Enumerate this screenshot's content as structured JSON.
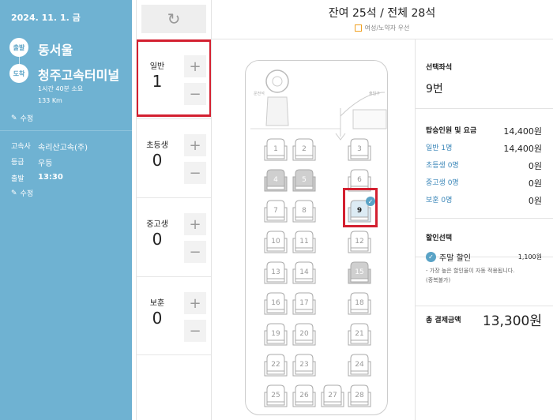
{
  "sidebar": {
    "date": "2024. 11. 1. 금",
    "departure": {
      "badge": "출발",
      "name": "동서울"
    },
    "arrival": {
      "badge": "도착",
      "name": "청주고속터미널",
      "duration": "1시간 40분 소요",
      "distance": "133 Km"
    },
    "edit_label": "수정",
    "info": [
      {
        "key": "고속사",
        "value": "속리산고속(주)"
      },
      {
        "key": "등급",
        "value": "우등"
      },
      {
        "key": "출발",
        "value": "13:30"
      }
    ],
    "edit_label_2": "수정"
  },
  "passengers": {
    "refresh_icon": "↻",
    "types": [
      {
        "label": "일반",
        "count": "1"
      },
      {
        "label": "초등생",
        "count": "0"
      },
      {
        "label": "중고생",
        "count": "0"
      },
      {
        "label": "보훈",
        "count": "0"
      }
    ],
    "plus": "+",
    "minus": "−"
  },
  "header": {
    "title": "잔여 25석 / 전체 28석",
    "legend": "여성/노약자 우선"
  },
  "bus": {
    "left_label": "운전석",
    "right_label": "출입구",
    "seats": [
      {
        "n": "1",
        "s": "free"
      },
      {
        "n": "2",
        "s": "free"
      },
      {
        "n": "3",
        "s": "free"
      },
      {
        "n": "4",
        "s": "taken"
      },
      {
        "n": "5",
        "s": "taken"
      },
      {
        "n": "6",
        "s": "free"
      },
      {
        "n": "7",
        "s": "free"
      },
      {
        "n": "8",
        "s": "free"
      },
      {
        "n": "9",
        "s": "selected"
      },
      {
        "n": "10",
        "s": "free"
      },
      {
        "n": "11",
        "s": "free"
      },
      {
        "n": "12",
        "s": "free"
      },
      {
        "n": "13",
        "s": "free"
      },
      {
        "n": "14",
        "s": "free"
      },
      {
        "n": "15",
        "s": "taken"
      },
      {
        "n": "16",
        "s": "free"
      },
      {
        "n": "17",
        "s": "free"
      },
      {
        "n": "18",
        "s": "free"
      },
      {
        "n": "19",
        "s": "free"
      },
      {
        "n": "20",
        "s": "free"
      },
      {
        "n": "21",
        "s": "free"
      },
      {
        "n": "22",
        "s": "free"
      },
      {
        "n": "23",
        "s": "free"
      },
      {
        "n": "24",
        "s": "free"
      },
      {
        "n": "25",
        "s": "free"
      },
      {
        "n": "26",
        "s": "free"
      },
      {
        "n": "27",
        "s": "free"
      },
      {
        "n": "28",
        "s": "free"
      }
    ]
  },
  "summary": {
    "selected_title": "선택좌석",
    "selected_seat": "9번",
    "fare_title": "탑승인원 및 요금",
    "fare_total": "14,400원",
    "rows": [
      {
        "label": "일반 1명",
        "value": "14,400원"
      },
      {
        "label": "초등생 0명",
        "value": "0원"
      },
      {
        "label": "중고생 0명",
        "value": "0원"
      },
      {
        "label": "보훈 0명",
        "value": "0원"
      }
    ],
    "discount_title": "할인선택",
    "discount_name": "주말 할인",
    "discount_value": "1,100원",
    "discount_note": "- 가장 높은 할인율이 자동 적용됩니다.",
    "discount_note2": "(중복불가)",
    "total_label": "총 결제금액",
    "total_value": "13,300원"
  },
  "colors": {
    "sidebar": "#6fb2d2",
    "accent": "#d32030",
    "taken": "#cfcfcf"
  }
}
